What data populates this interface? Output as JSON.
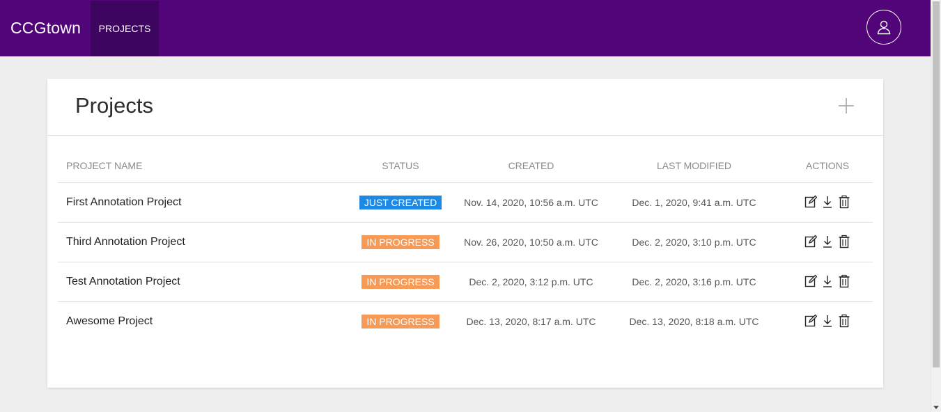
{
  "app": {
    "brand": "CCGtown"
  },
  "nav": {
    "projects_label": "PROJECTS"
  },
  "header": {
    "user_icon": "user-icon"
  },
  "page": {
    "title": "Projects",
    "add_icon": "plus-icon"
  },
  "table": {
    "columns": [
      "PROJECT NAME",
      "STATUS",
      "CREATED",
      "LAST MODIFIED",
      "ACTIONS"
    ],
    "rows": [
      {
        "name": "First Annotation Project",
        "status": "JUST CREATED",
        "created": "Nov. 14, 2020, 10:56 a.m. UTC",
        "modified": "Dec. 1, 2020, 9:41 a.m. UTC"
      },
      {
        "name": "Third Annotation Project",
        "status": "IN PROGRESS",
        "created": "Nov. 26, 2020, 10:50 a.m. UTC",
        "modified": "Dec. 2, 2020, 3:10 p.m. UTC"
      },
      {
        "name": "Test Annotation Project",
        "status": "IN PROGRESS",
        "created": "Dec. 2, 2020, 3:12 p.m. UTC",
        "modified": "Dec. 2, 2020, 3:16 p.m. UTC"
      },
      {
        "name": "Awesome Project",
        "status": "IN PROGRESS",
        "created": "Dec. 13, 2020, 8:17 a.m. UTC",
        "modified": "Dec. 13, 2020, 8:18 a.m. UTC"
      }
    ],
    "action_icons": [
      "edit-icon",
      "download-icon",
      "trash-icon"
    ]
  },
  "colors": {
    "topbar": "#520579",
    "nav_active": "#3d0460",
    "status_just_created": "#1e88e5",
    "status_in_progress": "#f79a55"
  }
}
